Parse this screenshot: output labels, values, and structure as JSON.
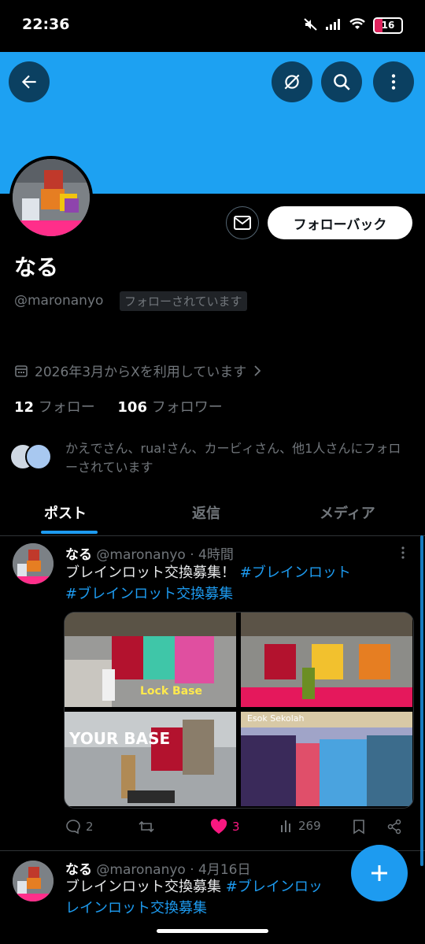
{
  "status_bar": {
    "time": "22:36",
    "battery": "16",
    "battery_level": 0.16
  },
  "profile": {
    "name": "なる",
    "handle": "@maronanyo",
    "follows_you": "フォローされています",
    "follow_back_label": "フォローバック",
    "joined": "2026年3月からXを利用しています",
    "following_count": "12",
    "following_label": "フォロー",
    "followers_count": "106",
    "followers_label": "フォロワー",
    "mutuals_text": "かえでさん、rua!さん、カービィさん、他1人さんにフォローされています"
  },
  "tabs": [
    "ポスト",
    "返信",
    "メディア"
  ],
  "posts": [
    {
      "name": "なる",
      "handle": "@maronanyo",
      "time": "· 4時間",
      "text": "ブレインロット交換募集！",
      "hashtag1": "#ブレインロット",
      "hashtag2": "#ブレインロット交換募集",
      "media_labels": [
        "Lock Base",
        "YOUR BASE",
        "Esok Sekolah"
      ],
      "replies": "2",
      "likes": "3",
      "views": "269"
    },
    {
      "name": "なる",
      "handle": "@maronanyo",
      "time": "· 4月16日",
      "text": "ブレインロット交換募集",
      "hashtag1": "#ブレインロッ",
      "hashtag2": "レインロット交換募集"
    }
  ],
  "colors": {
    "accent": "#1d9bf0",
    "banner": "#1da1f2",
    "like": "#f91880",
    "background": "#000000"
  },
  "icons": [
    "back-arrow-icon",
    "eye-slash-icon",
    "search-icon",
    "more-vertical-icon",
    "mail-icon",
    "calendar-icon",
    "chevron-right-icon",
    "reply-icon",
    "repost-icon",
    "heart-icon",
    "views-icon",
    "bookmark-icon",
    "share-icon",
    "plus-icon"
  ]
}
